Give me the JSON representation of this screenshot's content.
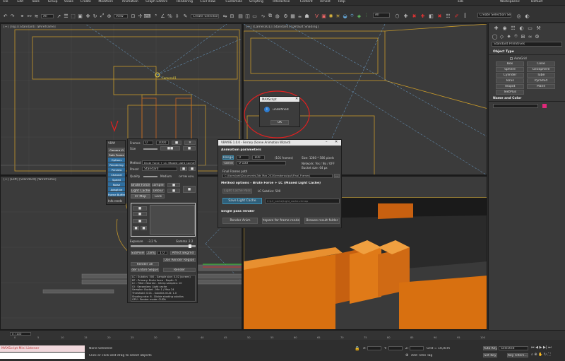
{
  "menubar": {
    "items": [
      "File",
      "Edit",
      "Tools",
      "Group",
      "Views",
      "Create",
      "Modifiers",
      "Animation",
      "Graph Editors",
      "Rendering",
      "Civil View",
      "Customize",
      "Scripting",
      "Interactive",
      "Content",
      "Arnold",
      "Help"
    ],
    "user_label": "seb",
    "workspaces_label": "Workspaces:",
    "workspace_value": "Default"
  },
  "toolbar": {
    "view_dropdown": "View",
    "selection_set": "Create Selection Se",
    "all_dropdown": "All"
  },
  "viewports": {
    "top_label": "[+] [Top] [Standard] [Wireframe]",
    "camera_label": "[+] [Camera01] [Standard] [Default Shading]",
    "left_label": "[+] [Left] [Standard] [Wireframe]",
    "perspective_label": "[+] [Perspective] [Standard] [Default Shading]",
    "object_label": "Camera01"
  },
  "command_panel": {
    "dropdown": "Standard Primitives",
    "object_type_title": "Object Type",
    "autogrid": "AutoGrid",
    "buttons": [
      "Box",
      "Cone",
      "Sphere",
      "GeoSphere",
      "Cylinder",
      "Tube",
      "Torus",
      "Pyramid",
      "Teapot",
      "Plane",
      "TextPlus"
    ],
    "name_color_title": "Name and Color",
    "accent_color": "#e0287a"
  },
  "maxscript_dialog": {
    "title": "MAXScript",
    "message": "undefined",
    "ok": "OK",
    "icon": "info-icon"
  },
  "side_menu": {
    "title": "VRAY",
    "items": [
      "Camera Vi",
      "Safe Frame",
      "Options",
      "Rendering",
      "Preview",
      "Channel",
      "Speed",
      "Noise",
      "Adaptive",
      "Frame Buffer"
    ],
    "footer": "Info rends"
  },
  "render_panel": {
    "frames_label": "Frames",
    "frames_value": "0",
    "end_value": "1000",
    "size_label": "Size",
    "method_label": "Method",
    "method_value": "Brute Force + LC (Maxed Light Cache)",
    "preset_label": "Preset",
    "preset_value": "Standard",
    "quality_label": "Quality",
    "quality_value": "Medium",
    "quality_pct": "OPTIM 60%",
    "buttons_row1": [
      "Brute Force",
      "Light Cache",
      "Irr Map"
    ],
    "buttons_row2": [
      "Sampler",
      "Deblur",
      "Lock"
    ],
    "exposure_label": "Exposure",
    "exposure_value": "-3.2 %",
    "gamma_label": "Gamma",
    "gamma_value": "2.2",
    "bottom_buttons": [
      "SubPixel",
      "Clamp",
      "1.0",
      "Affect Bkgrnd"
    ],
    "passes_label": "Render all",
    "final_buttons": [
      "Use Render Region",
      "Render Entire Sequence",
      "Render"
    ],
    "log_lines": [
      "LC : Subdivs: 500 - Sample size: 0.02 (screen)",
      "BF : Primary: Brute force - Depth: 3",
      "LC : Filter: Nearest - Interp samples: 10",
      "GI : Secondary: Light cache",
      "Sampler: Bucket - Min 1 / Max 24",
      "Threshold: 0.01 - Subdivs mult: 1.0",
      "Shading rate: 6 - Divide shading subdivs",
      "GPU : Render mode: CUDA"
    ]
  },
  "wizard": {
    "title": "VRAYRE 1.0.0 - Ferrary (Scene Animation Wizard)",
    "section1": "Animation parameters",
    "range_label": "Range",
    "range_from": "0",
    "range_to": "100",
    "range_info": "(101 frames)",
    "range_right": "Size: 1280 * 586 pixels",
    "frames_label": "Frames",
    "frames_value": "0-100",
    "network_label": "Network: Yes / No / OFF",
    "network_right": "Bucket size: 64 px",
    "output_label": "Final Frames path",
    "output_value": "C:\\Users\\seb\\Documents\\3ds Max 2024\\renderoutput\\Final_Frames\\",
    "section2": "Method options - Brute Force + LC (Maxed Light Cache)",
    "lc_pass_btn": "Light Cache Pass",
    "lc_info": "LC Subdivs: 500",
    "save_lc_btn": "Save Light Cache",
    "lc_path": "C:\\LC_cache\\Light_cache.vrlmap",
    "section3": "Single pass render",
    "render_anim_btn": "Render Anim",
    "prepare_btn": "Prepare for frame render",
    "browse_btn": "Browse result folder"
  },
  "timeline": {
    "frame_indicator": "0 / 100",
    "ticks": [
      "0",
      "5",
      "10",
      "15",
      "20",
      "25",
      "30",
      "35",
      "40",
      "45",
      "50",
      "55",
      "60",
      "65",
      "70",
      "75",
      "80",
      "85",
      "90",
      "95",
      "100"
    ]
  },
  "statusbar": {
    "maxscript_line": "MAXScript Mini Listener",
    "status_top": "None Selected",
    "status_bottom": "Click or click-and-drag to select objects",
    "x_label": "X:",
    "y_label": "Y:",
    "z_label": "Z:",
    "grid_label": "Grid = 10,0cm",
    "add_time_tag": "Add Time Tag",
    "auto_key": "Auto Key",
    "selected_value": "Selected",
    "set_key": "Set Key",
    "key_filters": "Key Filters..."
  }
}
